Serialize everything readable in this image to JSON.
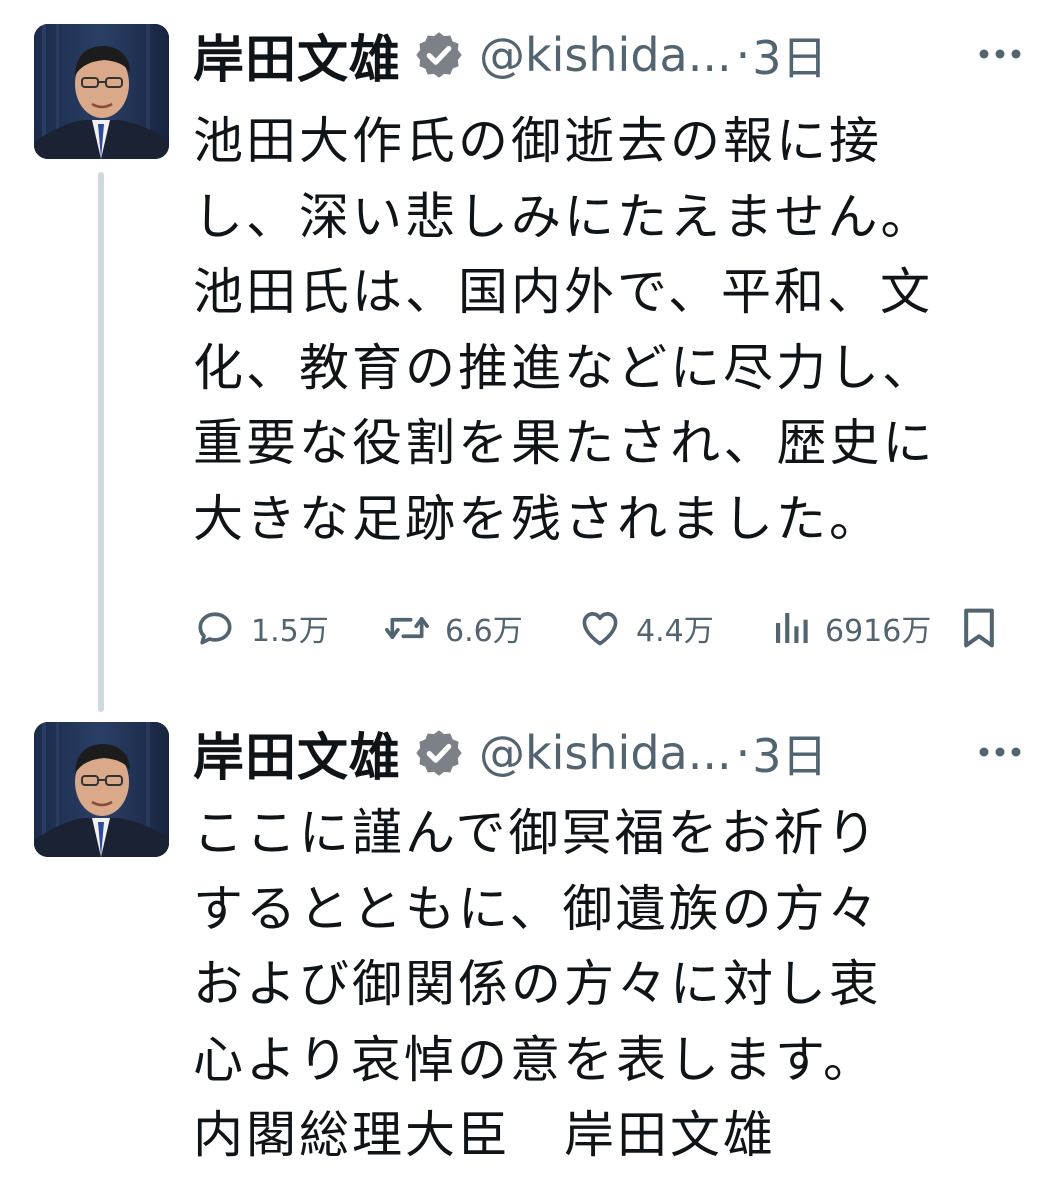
{
  "tweets": [
    {
      "author": {
        "name": "岸田文雄",
        "handle": "@kishida...",
        "verified": true
      },
      "separator": "·",
      "time": "3日",
      "text_lines": [
        "池田大作氏の御逝去の報に接",
        "し、深い悲しみにたえません。",
        "池田氏は、国内外で、平和、文",
        "化、教育の推進などに尽力し、",
        "重要な役割を果たされ、歴史に",
        "大きな足跡を残されました。"
      ],
      "stats": {
        "replies": "1.5万",
        "retweets": "6.6万",
        "likes": "4.4万",
        "views": "6916万"
      }
    },
    {
      "author": {
        "name": "岸田文雄",
        "handle": "@kishida...",
        "verified": true
      },
      "separator": "·",
      "time": "3日",
      "text_lines": [
        "ここに謹んで御冥福をお祈り",
        "するとともに、御遺族の方々",
        "および御関係の方々に対し衷",
        "心より哀悼の意を表します。",
        "内閣総理大臣　岸田文雄"
      ]
    }
  ],
  "icons": {
    "verified": "verified-badge-icon",
    "more": "more-dots-icon",
    "reply": "reply-icon",
    "retweet": "retweet-icon",
    "like": "heart-icon",
    "views": "views-icon",
    "bookmark": "bookmark-icon"
  },
  "colors": {
    "text": "#0f1419",
    "secondary": "#536471",
    "thread_line": "#cfd9de",
    "verified_badge": "#7b8186"
  }
}
